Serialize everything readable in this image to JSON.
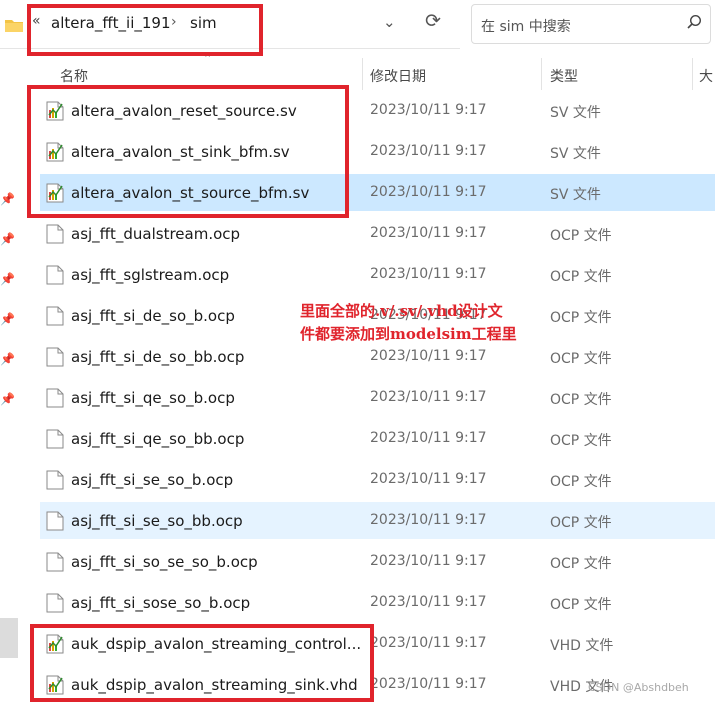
{
  "address_bar": {
    "chevron": "«",
    "crumbs": [
      "altera_fft_ii_191",
      "sim"
    ],
    "separator": "›",
    "dropdown": "⌄",
    "refresh": "⟳"
  },
  "search": {
    "placeholder": "在 sim 中搜索"
  },
  "columns": {
    "name": "名称",
    "date": "修改日期",
    "type": "类型",
    "size": "大"
  },
  "files": [
    {
      "name": "altera_avalon_reset_source.sv",
      "date": "2023/10/11 9:17",
      "type": "SV 文件",
      "icon": "sv-file-icon"
    },
    {
      "name": "altera_avalon_st_sink_bfm.sv",
      "date": "2023/10/11 9:17",
      "type": "SV 文件",
      "icon": "sv-file-icon"
    },
    {
      "name": "altera_avalon_st_source_bfm.sv",
      "date": "2023/10/11 9:17",
      "type": "SV 文件",
      "icon": "sv-file-icon",
      "selected": true
    },
    {
      "name": "asj_fft_dualstream.ocp",
      "date": "2023/10/11 9:17",
      "type": "OCP 文件",
      "icon": "generic-file-icon"
    },
    {
      "name": "asj_fft_sglstream.ocp",
      "date": "2023/10/11 9:17",
      "type": "OCP 文件",
      "icon": "generic-file-icon"
    },
    {
      "name": "asj_fft_si_de_so_b.ocp",
      "date": "2023/10/11 9:17",
      "type": "OCP 文件",
      "icon": "generic-file-icon"
    },
    {
      "name": "asj_fft_si_de_so_bb.ocp",
      "date": "2023/10/11 9:17",
      "type": "OCP 文件",
      "icon": "generic-file-icon"
    },
    {
      "name": "asj_fft_si_qe_so_b.ocp",
      "date": "2023/10/11 9:17",
      "type": "OCP 文件",
      "icon": "generic-file-icon"
    },
    {
      "name": "asj_fft_si_qe_so_bb.ocp",
      "date": "2023/10/11 9:17",
      "type": "OCP 文件",
      "icon": "generic-file-icon"
    },
    {
      "name": "asj_fft_si_se_so_b.ocp",
      "date": "2023/10/11 9:17",
      "type": "OCP 文件",
      "icon": "generic-file-icon"
    },
    {
      "name": "asj_fft_si_se_so_bb.ocp",
      "date": "2023/10/11 9:17",
      "type": "OCP 文件",
      "icon": "generic-file-icon",
      "hover": true
    },
    {
      "name": "asj_fft_si_so_se_so_b.ocp",
      "date": "2023/10/11 9:17",
      "type": "OCP 文件",
      "icon": "generic-file-icon"
    },
    {
      "name": "asj_fft_si_sose_so_b.ocp",
      "date": "2023/10/11 9:17",
      "type": "OCP 文件",
      "icon": "generic-file-icon"
    },
    {
      "name": "auk_dspip_avalon_streaming_control...",
      "date": "2023/10/11 9:17",
      "type": "VHD 文件",
      "icon": "sv-file-icon"
    },
    {
      "name": "auk_dspip_avalon_streaming_sink.vhd",
      "date": "2023/10/11 9:17",
      "type": "VHD 文件",
      "icon": "sv-file-icon"
    }
  ],
  "annotation": {
    "line1": "里面全部的.v/.sv/.vhd设计文",
    "line2": "件都要添加到modelsim工程里"
  },
  "watermark": "CSDN @Abshdbeh",
  "colors": {
    "highlight_red": "#e0242c",
    "selected_row": "#cce8ff",
    "hover_row": "#e5f3ff"
  }
}
